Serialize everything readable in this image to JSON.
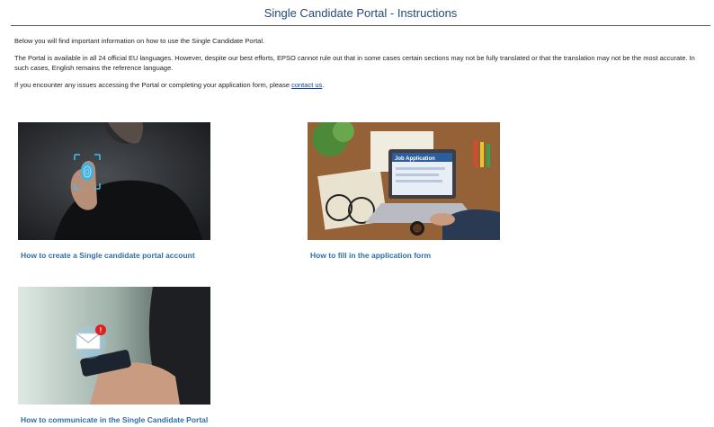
{
  "header": {
    "title": "Single Candidate Portal - Instructions"
  },
  "intro": {
    "p1": "Below you will find important information on how to use the Single Candidate Portal.",
    "p2": "The Portal is available in all 24 official EU languages. However, despite our best efforts, EPSO cannot rule out that in some cases certain sections may not be fully translated or that the translation may not be the most accurate. In such cases, English remains the reference language.",
    "p3_before": "If you encounter any issues accessing the Portal or completing your application form, please ",
    "p3_link": "contact us",
    "p3_after": "."
  },
  "cards": [
    {
      "caption": "How to create a Single candidate portal account",
      "image_icon": "fingerprint-scan-icon"
    },
    {
      "caption": "How to fill in the application form",
      "image_icon": "laptop-job-application-icon",
      "screen_text": "Job Application"
    },
    {
      "caption": "How to communicate in the Single Candidate Portal",
      "image_icon": "phone-email-notification-icon"
    }
  ]
}
